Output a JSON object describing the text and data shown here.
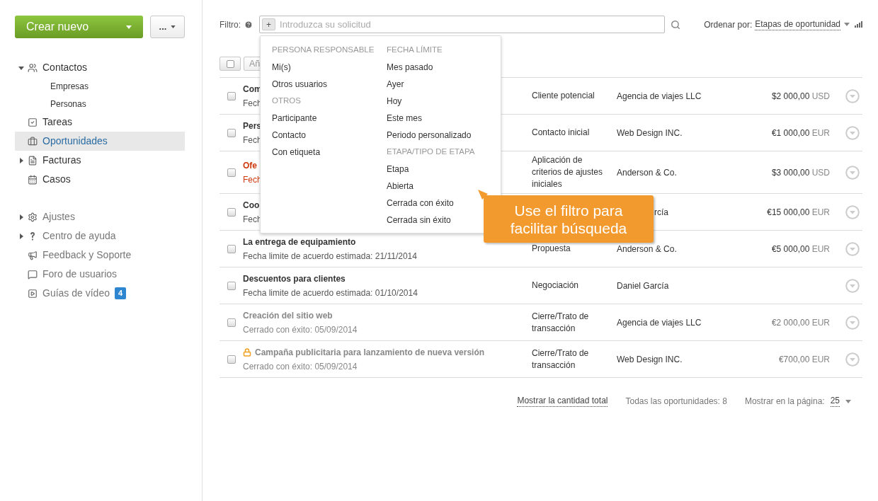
{
  "sidebar": {
    "create_button": "Crear nuevo",
    "more_button": "...",
    "nav": [
      {
        "label": "Contactos",
        "expanded": true,
        "selected": false,
        "children": [
          {
            "label": "Empresas"
          },
          {
            "label": "Personas"
          }
        ]
      },
      {
        "label": "Tareas",
        "selected": false
      },
      {
        "label": "Oportunidades",
        "selected": true
      },
      {
        "label": "Facturas",
        "expanded": false,
        "selected": false
      },
      {
        "label": "Casos",
        "selected": false
      }
    ],
    "help": [
      {
        "label": "Ajustes",
        "expanded": false
      },
      {
        "label": "Centro de ayuda",
        "expanded": false
      },
      {
        "label": "Feedback y Soporte"
      },
      {
        "label": "Foro de usuarios"
      },
      {
        "label": "Guías de vídeo",
        "badge": "4"
      }
    ]
  },
  "filter": {
    "label": "Filtro:",
    "tag": "+",
    "placeholder": "Introduzca su solicitud",
    "sort_label": "Ordenar por:",
    "sort_value": "Etapas de oportunidad"
  },
  "toolbar": {
    "add_button": "Añ"
  },
  "filter_menu": {
    "columns": [
      {
        "groups": [
          {
            "heading": "PERSONA RESPONSABLE",
            "items": [
              "Mi(s)",
              "Otros usuarios"
            ]
          },
          {
            "heading": "OTROS",
            "items": [
              "Participante",
              "Contacto",
              "Con etiqueta"
            ]
          }
        ]
      },
      {
        "groups": [
          {
            "heading": "FECHA LÍMITE",
            "items": [
              "Mes pasado",
              "Ayer",
              "Hoy",
              "Este mes",
              "Periodo personalizado"
            ]
          },
          {
            "heading": "ETAPA/TIPO DE ETAPA",
            "items": [
              "Etapa",
              "Abierta",
              "Cerrada con éxito",
              "Cerrada sin éxito"
            ]
          }
        ]
      }
    ]
  },
  "callout": "Use el filtro para facilitar búsqueda",
  "rows": [
    {
      "kind": "open",
      "checked": false,
      "title": "Com",
      "date": "Fech",
      "stage": "Cliente potencial",
      "company": "Agencia de viajes LLC",
      "amount": "$2 000,00",
      "currency": "USD"
    },
    {
      "kind": "open",
      "checked": false,
      "title": "Pers",
      "date": "Fech",
      "stage": "Contacto inicial",
      "company": "Web Design INC.",
      "amount": "€1 000,00",
      "currency": "EUR"
    },
    {
      "kind": "overdue",
      "checked": false,
      "title": "Ofe",
      "date": "Fech",
      "stage": "Aplicación de criterios de ajustes iniciales",
      "company": "Anderson & Co.",
      "amount": "$3 000,00",
      "currency": "USD"
    },
    {
      "kind": "open",
      "checked": false,
      "title": "Coo",
      "date": "Fech",
      "company": "rcía",
      "covered": true,
      "amount": "€15 000,00",
      "currency": "EUR"
    },
    {
      "kind": "open",
      "checked": false,
      "title": "La entrega de equipamiento",
      "date": "Fecha limite de acuerdo estimada: 21/11/2014",
      "stage": "Propuesta",
      "company": "Anderson & Co.",
      "amount": "€5 000,00",
      "currency": "EUR"
    },
    {
      "kind": "open",
      "checked": false,
      "title": "Descuentos para clientes",
      "date": "Fecha limite de acuerdo estimada: 01/10/2014",
      "stage": "Negociación",
      "company": "Daniel García"
    },
    {
      "kind": "closed",
      "checked": false,
      "title": "Creación del sitio web",
      "date": "Cerrado con éxito: 05/09/2014",
      "stage": "Cierre/Trato de transacción",
      "company": "Agencia de viajes LLC",
      "amount": "€2 000,00",
      "currency": "EUR"
    },
    {
      "kind": "closed",
      "checked": false,
      "locked": true,
      "title": "Campaña publicitaria para lanzamiento de nueva versión",
      "date": "Cerrado con éxito: 05/09/2014",
      "stage": "Cierre/Trato de transacción",
      "company": "Web Design INC.",
      "amount": "€700,00",
      "currency": "EUR"
    }
  ],
  "footer": {
    "total_link": "Mostrar la cantidad total",
    "count": "Todas las oportunidades: 8",
    "per_page_label": "Mostrar en la página:",
    "per_page": "25"
  }
}
